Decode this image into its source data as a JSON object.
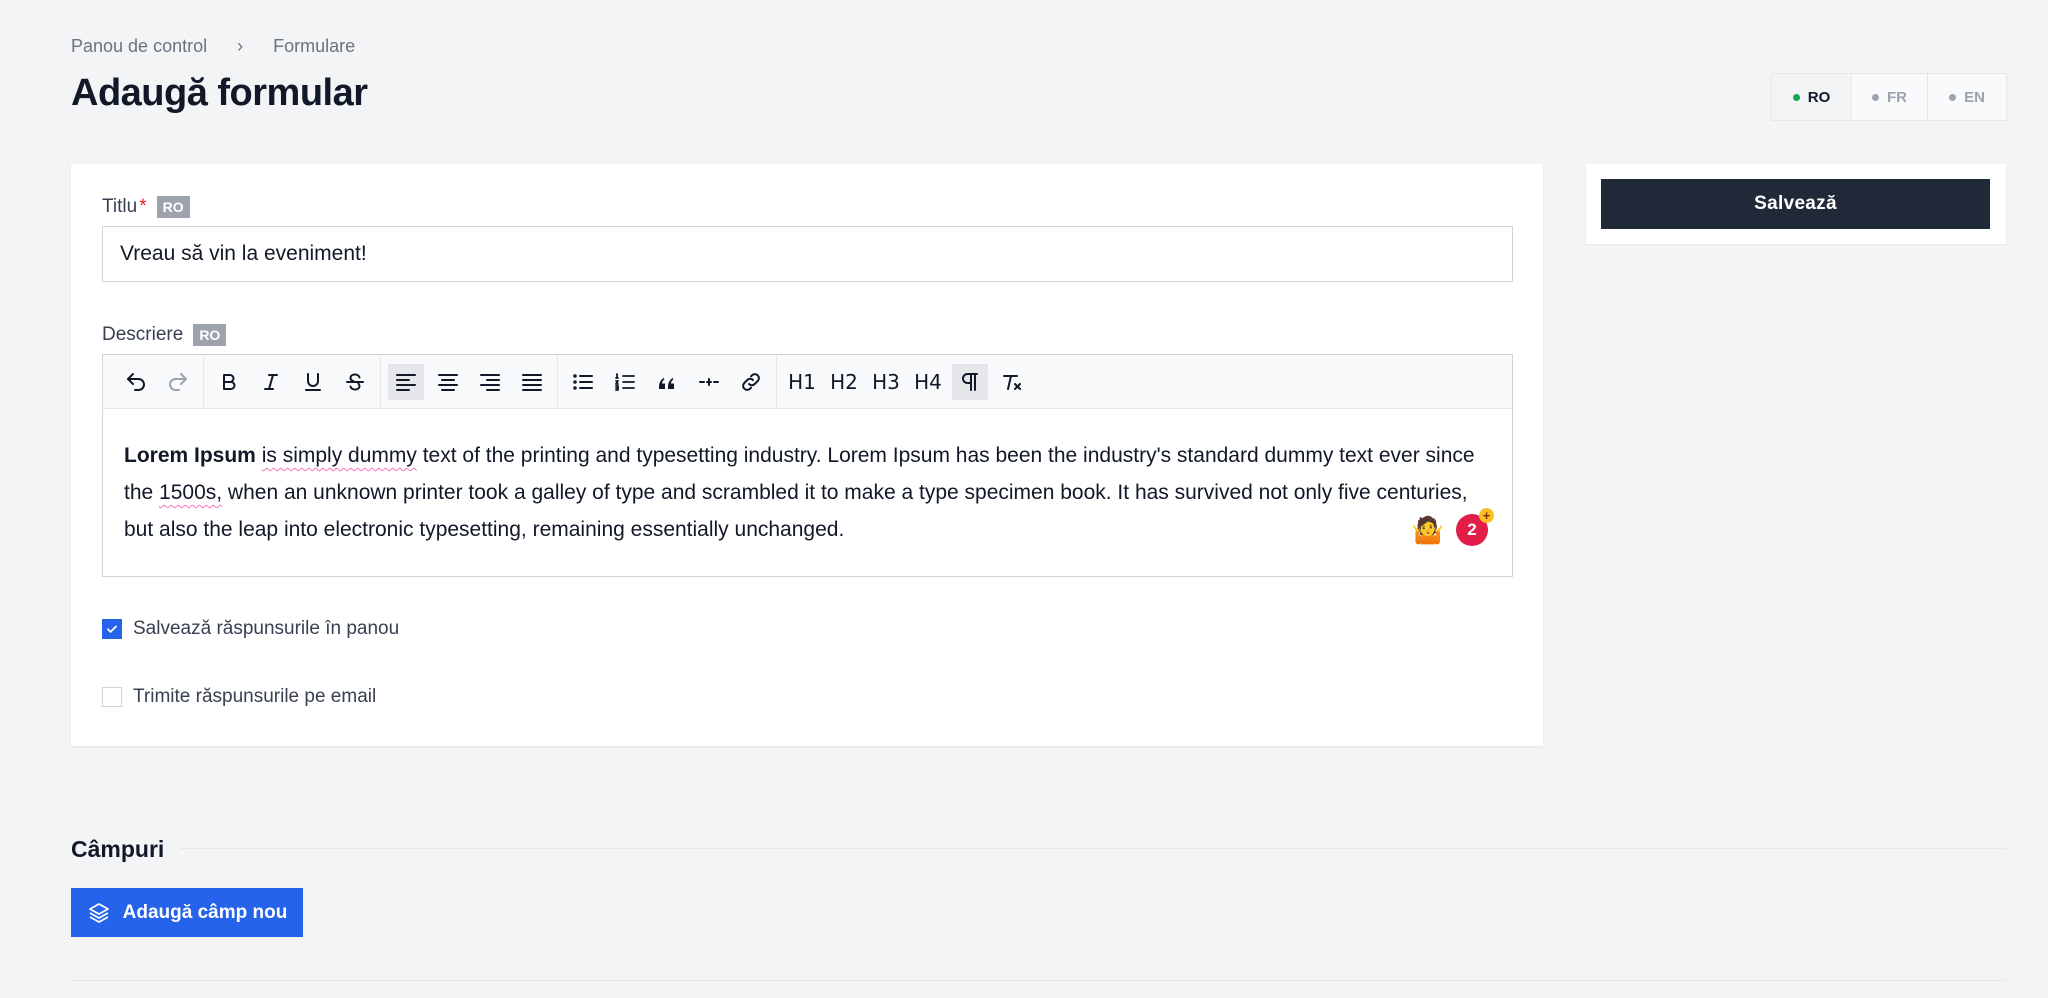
{
  "breadcrumb": {
    "items": [
      "Panou de control",
      "Formulare"
    ],
    "separator": "›"
  },
  "page": {
    "title": "Adaugă formular"
  },
  "languages": {
    "active": "RO",
    "items": [
      {
        "label": "RO",
        "active": true
      },
      {
        "label": "FR",
        "active": false
      },
      {
        "label": "EN",
        "active": false
      }
    ]
  },
  "form": {
    "title_label": "Titlu",
    "required_mark": "*",
    "lang_badge": "RO",
    "title_value": "Vreau să vin la eveniment!",
    "description_label": "Descriere",
    "description": {
      "bold": "Lorem Ipsum",
      "spell1": "is simply dummy",
      "part1": " text of the printing and typesetting industry. Lorem Ipsum has been the industry's standard dummy text ever since the ",
      "spell2": "1500s,",
      "part2": " when an unknown printer took a galley of type and scrambled it to make a type specimen book. It has survived not only five centuries, but also the leap into electronic typesetting, remaining essentially unchanged."
    },
    "save_responses_label": "Salvează răspunsurile în panou",
    "save_responses_checked": true,
    "email_responses_label": "Trimite răspunsurile pe email",
    "email_responses_checked": false
  },
  "toolbar": {
    "groups": [
      [
        "undo-icon",
        "redo-icon"
      ],
      [
        "bold-icon",
        "italic-icon",
        "underline-icon",
        "strikethrough-icon"
      ],
      [
        "align-left-icon",
        "align-center-icon",
        "align-right-icon",
        "align-justify-icon"
      ],
      [
        "bullet-list-icon",
        "ordered-list-icon",
        "blockquote-icon",
        "horizontal-rule-icon",
        "link-icon"
      ],
      [
        "heading-1-icon",
        "heading-2-icon",
        "heading-3-icon",
        "heading-4-icon",
        "paragraph-icon",
        "clear-format-icon"
      ]
    ],
    "heading_labels": [
      "H1",
      "H2",
      "H3",
      "H4"
    ]
  },
  "extension": {
    "emoji": "🤷",
    "count": "2",
    "plus": "+"
  },
  "sidebar": {
    "save_label": "Salvează"
  },
  "fields_section": {
    "title": "Câmpuri",
    "add_label": "Adaugă câmp nou",
    "add_icon": "layers-icon"
  },
  "colors": {
    "primary": "#2563eb",
    "dark": "#1f2937",
    "danger": "#e11d48",
    "active_dot": "#16a34a"
  }
}
